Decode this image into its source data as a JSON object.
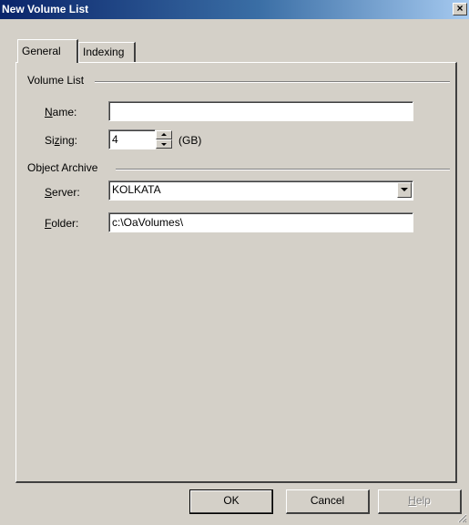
{
  "window": {
    "title": "New Volume List",
    "close_glyph": "×"
  },
  "tabs": [
    {
      "label": "General",
      "active": true
    },
    {
      "label": "Indexing",
      "active": false
    }
  ],
  "volume_list": {
    "group_label": "Volume List",
    "name": {
      "label": "Name:",
      "mnemonic": "N",
      "rest": "ame:",
      "value": ""
    },
    "sizing": {
      "label": "Sizing:",
      "pre": "Si",
      "mnemonic": "z",
      "rest": "ing:",
      "value": "4",
      "unit": "(GB)"
    }
  },
  "object_archive": {
    "group_label": "Object Archive",
    "server": {
      "label": "Server:",
      "mnemonic": "S",
      "rest": "erver:",
      "value": "KOLKATA"
    },
    "folder": {
      "label": "Folder:",
      "mnemonic": "F",
      "rest": "older:",
      "value": "c:\\OaVolumes\\"
    }
  },
  "buttons": {
    "ok": "OK",
    "cancel": "Cancel",
    "help_mnemonic": "H",
    "help_rest": "elp"
  }
}
